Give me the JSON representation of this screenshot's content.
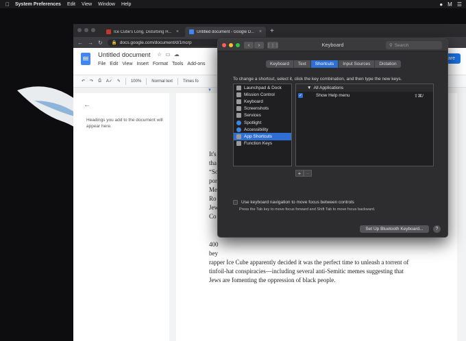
{
  "menubar": {
    "app_name": "System Preferences",
    "items": [
      "Edit",
      "View",
      "Window",
      "Help"
    ]
  },
  "browser": {
    "tabs": [
      {
        "label": "Ice Cube's Long, Disturbing H...",
        "favicon_color": "#c0392b"
      },
      {
        "label": "Untitled document - Google D...",
        "favicon_color": "#4285f4"
      }
    ],
    "url": "docs.google.com/document/d/1mcrp"
  },
  "docs": {
    "title": "Untitled document",
    "menu": [
      "File",
      "Edit",
      "View",
      "Insert",
      "Format",
      "Tools",
      "Add-ons"
    ],
    "share_label": "are",
    "format": {
      "zoom": "100%",
      "style": "Normal text",
      "font": "Times fo"
    },
    "outline_hint": "Headings you add to the document will appear here.",
    "body_fragments": [
      "It's",
      "tha",
      "“So",
      "por",
      "Me",
      "Ro",
      "Jew",
      "Co",
      "400",
      "bey"
    ],
    "body_lines": [
      "rapper Ice Cube apparently decided it was the perfect time to unleash a torrent of",
      "tinfoil-hat conspiracies—including several anti-Semitic memes suggesting that",
      "Jews are fomenting the oppression of black people."
    ]
  },
  "prefs": {
    "window_title": "Keyboard",
    "search_placeholder": "Search",
    "tabs": [
      "Keyboard",
      "Text",
      "Shortcuts",
      "Input Sources",
      "Dictation"
    ],
    "active_tab": "Shortcuts",
    "instructions": "To change a shortcut, select it, click the key combination, and then type the new keys.",
    "categories": [
      "Launchpad & Dock",
      "Mission Control",
      "Keyboard",
      "Screenshots",
      "Services",
      "Spotlight",
      "Accessibility",
      "App Shortcuts",
      "Function Keys"
    ],
    "selected_category": "App Shortcuts",
    "group_label": "All Applications",
    "shortcut": {
      "label": "Show Help menu",
      "keys": "⇧⌘/"
    },
    "add_label": "+",
    "remove_label": "−",
    "kbnav_label": "Use keyboard navigation to move focus between controls",
    "kbnav_hint": "Press the Tab key to move focus forward and Shift Tab to move focus backward.",
    "bt_button": "Set Up Bluetooth Keyboard...",
    "help_label": "?"
  },
  "colors": {
    "accent": "#2f6fd4",
    "docs_blue": "#4285f4"
  }
}
